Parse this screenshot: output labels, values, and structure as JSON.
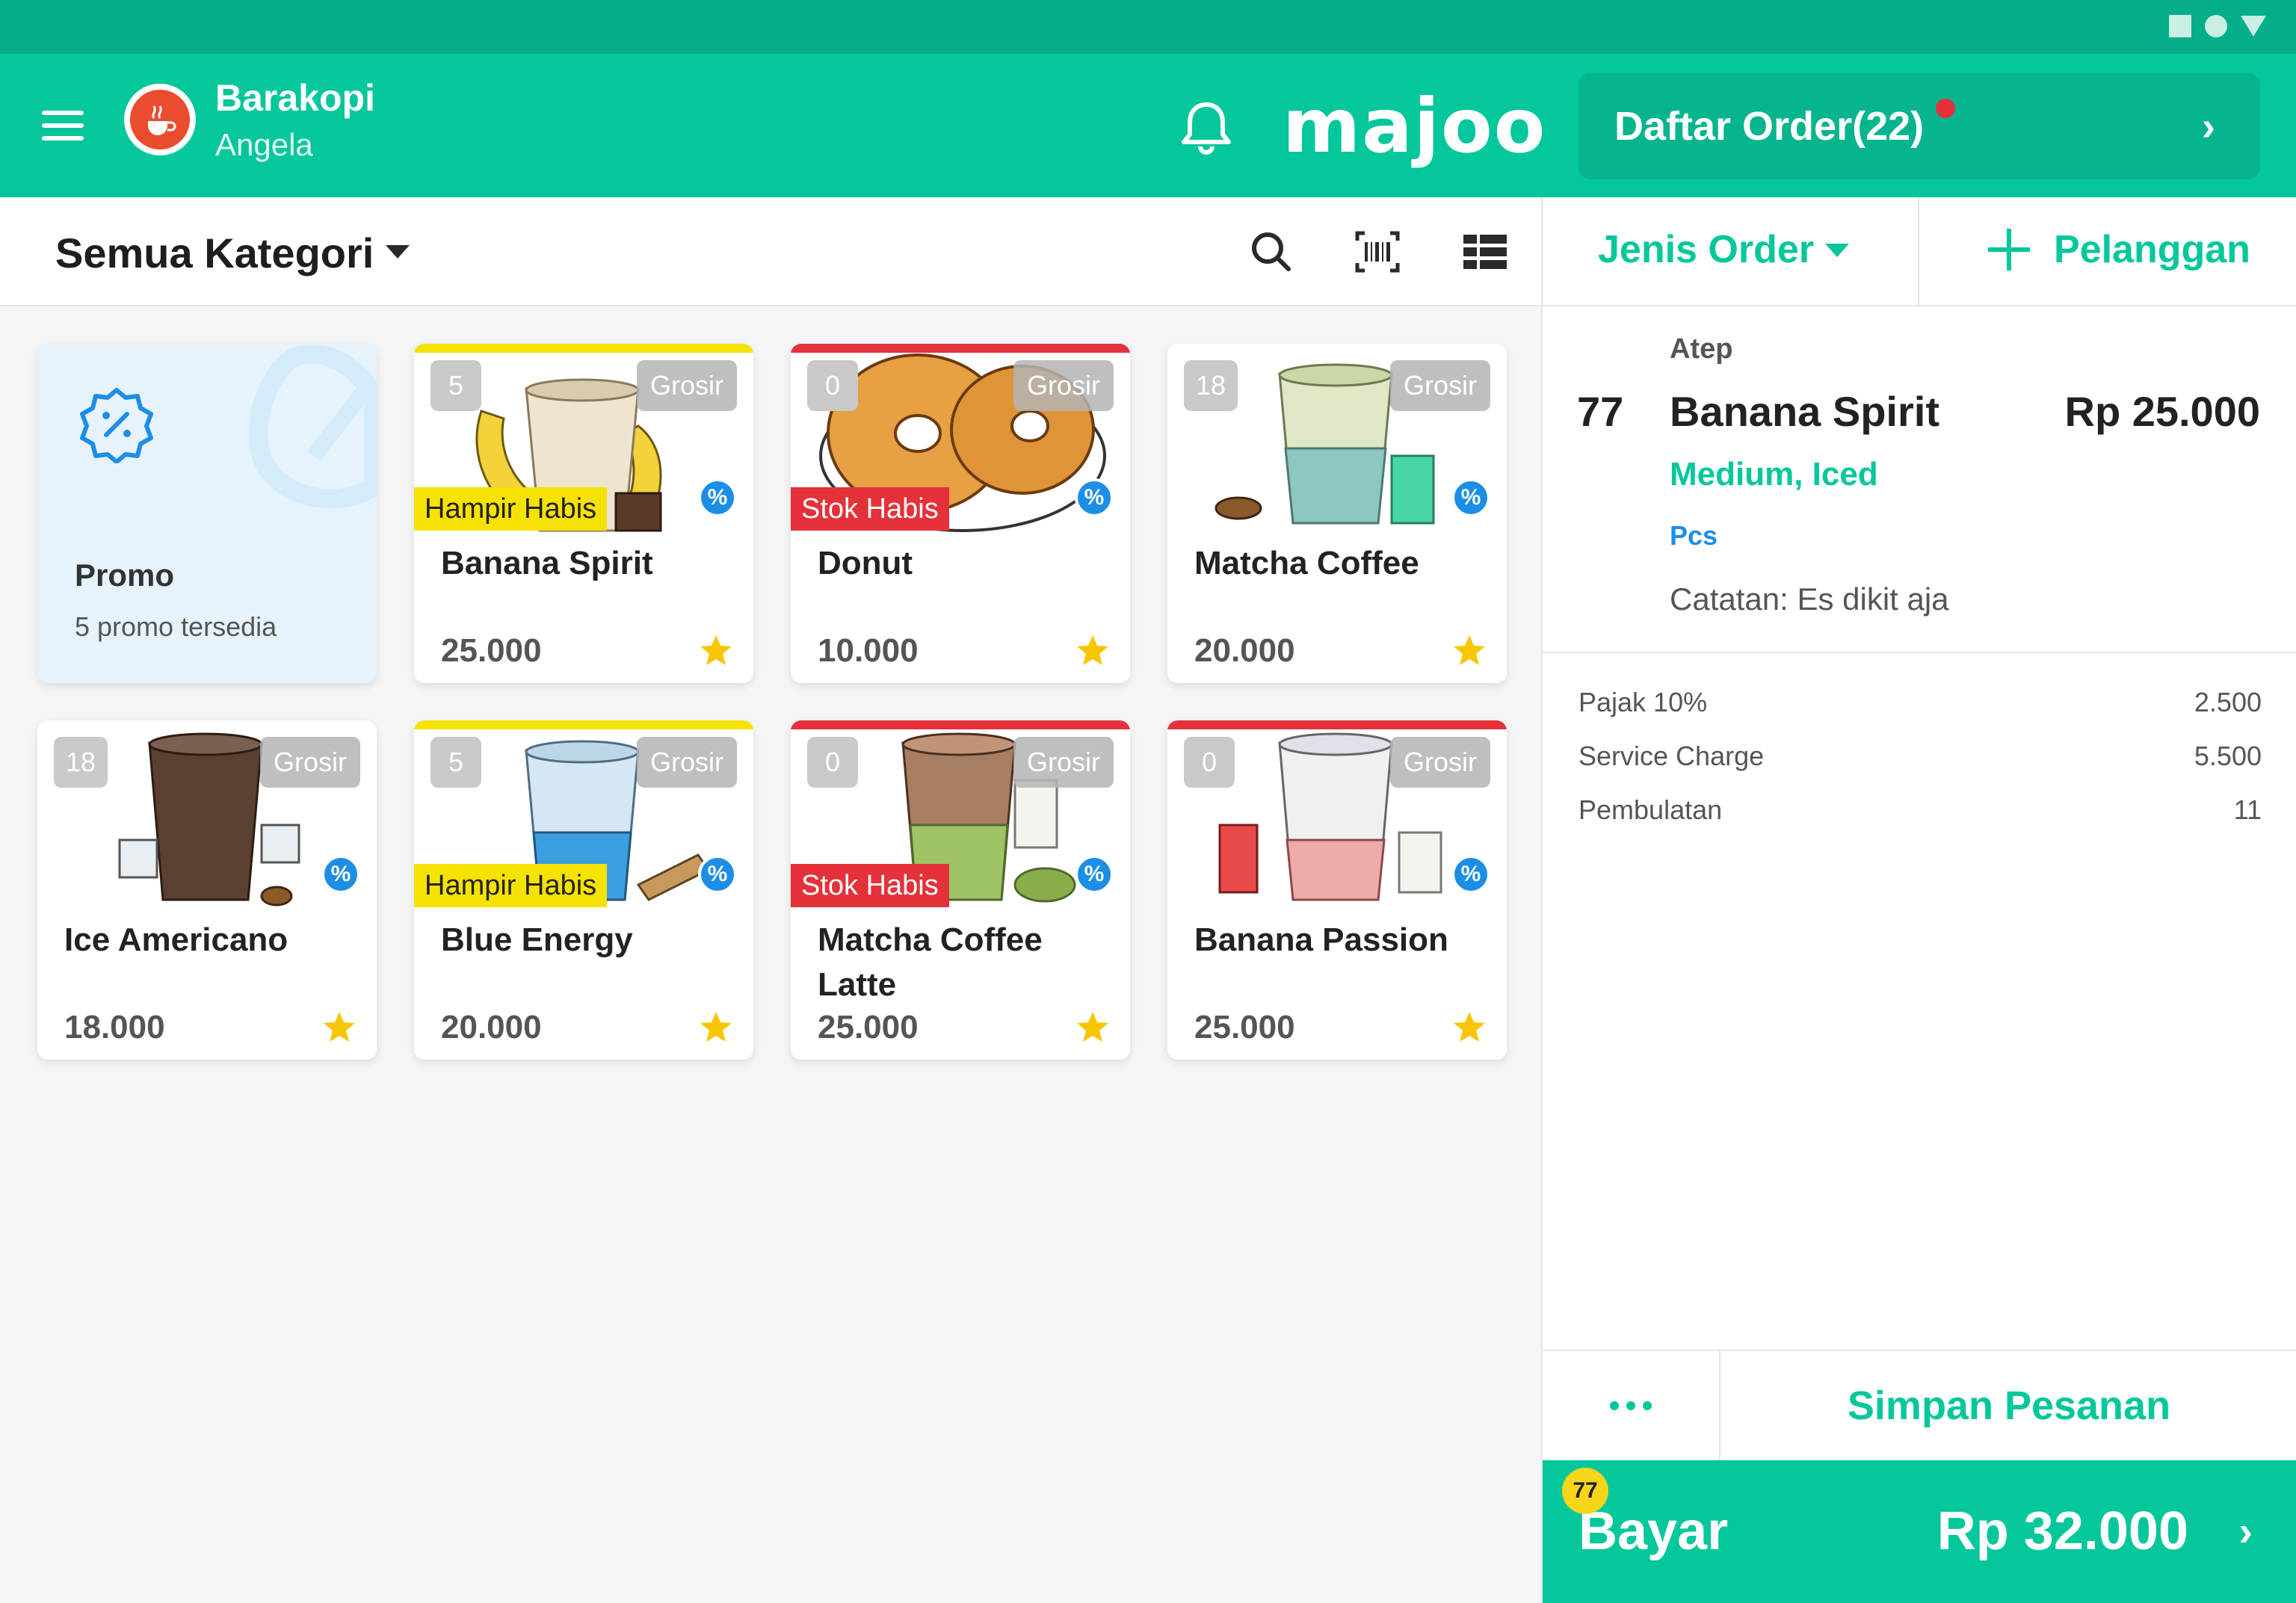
{
  "header": {
    "store_name": "Barakopi",
    "user_name": "Angela",
    "brand": "majoo",
    "order_list_label": "Daftar Order(22)",
    "icons": [
      "menu-icon",
      "bell-icon",
      "chevron-right-icon"
    ]
  },
  "toolbar": {
    "category_label": "Semua Kategori",
    "icons": [
      "search-icon",
      "barcode-icon",
      "grid-view-icon"
    ]
  },
  "promo_card": {
    "title": "Promo",
    "subtitle": "5 promo tersedia"
  },
  "products": [
    {
      "name": "Banana Spirit",
      "price": "25.000",
      "stock": "5",
      "tag": "Grosir",
      "flag": "Hampir Habis",
      "flag_type": "warn",
      "topbar": "#f6e200"
    },
    {
      "name": "Donut",
      "price": "10.000",
      "stock": "0",
      "tag": "Grosir",
      "flag": "Stok Habis",
      "flag_type": "out",
      "topbar": "#e4313a"
    },
    {
      "name": "Matcha Coffee",
      "price": "20.000",
      "stock": "18",
      "tag": "Grosir",
      "flag": "",
      "flag_type": "",
      "topbar": ""
    },
    {
      "name": "Ice Americano",
      "price": "18.000",
      "stock": "18",
      "tag": "Grosir",
      "flag": "",
      "flag_type": "",
      "topbar": ""
    },
    {
      "name": "Blue Energy",
      "price": "20.000",
      "stock": "5",
      "tag": "Grosir",
      "flag": "Hampir Habis",
      "flag_type": "warn",
      "topbar": "#f6e200"
    },
    {
      "name": "Matcha Coffee Latte",
      "price": "25.000",
      "stock": "0",
      "tag": "Grosir",
      "flag": "Stok Habis",
      "flag_type": "out",
      "topbar": "#e4313a"
    },
    {
      "name": "Banana Passion",
      "price": "25.000",
      "stock": "0",
      "tag": "Grosir",
      "flag": "",
      "flag_type": "",
      "topbar": "#e4313a"
    }
  ],
  "order_panel": {
    "order_type_label": "Jenis Order",
    "customer_label": "Pelanggan",
    "item": {
      "guest": "Atep",
      "qty": "77",
      "name": "Banana Spirit",
      "price": "Rp 25.000",
      "variant": "Medium, Iced",
      "unit": "Pcs",
      "note": "Catatan: Es dikit aja"
    },
    "summary": [
      {
        "label": "Pajak 10%",
        "value": "2.500"
      },
      {
        "label": "Service Charge",
        "value": "5.500"
      },
      {
        "label": "Pembulatan",
        "value": "11"
      }
    ],
    "save_label": "Simpan Pesanan",
    "pay_label": "Bayar",
    "pay_total": "Rp 32.000",
    "pay_badge": "77"
  },
  "colors": {
    "primary": "#04c79b",
    "statusbar": "#05ae88",
    "warning": "#f6e200",
    "danger": "#e4313a",
    "info": "#1c8ee6"
  }
}
